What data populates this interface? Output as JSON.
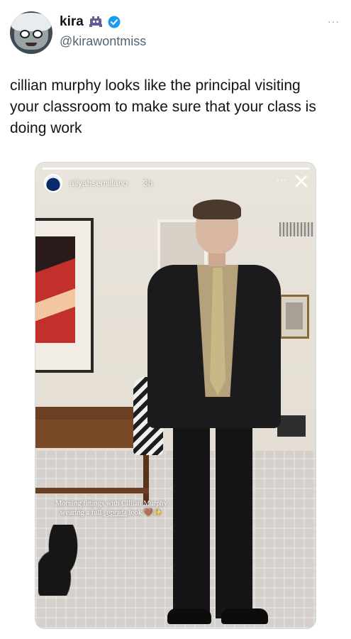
{
  "tweet": {
    "author": {
      "display_name": "kira",
      "handle": "@kirawontmiss",
      "emoji_icon": "space-invader-icon",
      "verified_icon": "verified-badge-icon",
      "verified_color": "#1d9bf0"
    },
    "text": "cillian murphy looks like the principal  visiting\nyour classroom to make sure that your class is\ndoing work",
    "more_icon": "more-horizontal-icon",
    "more_label": "···"
  },
  "story": {
    "username": "aliyahsemillano",
    "time": "3h",
    "dots": "···",
    "close_icon": "close-x-icon",
    "caption": {
      "line1": "Morning fittings with Cillian Murphy",
      "line2_prefix": "wearing a full ",
      "mention": "@prada",
      "line2_suffix": " look",
      "emojis": "🤎✨"
    }
  }
}
